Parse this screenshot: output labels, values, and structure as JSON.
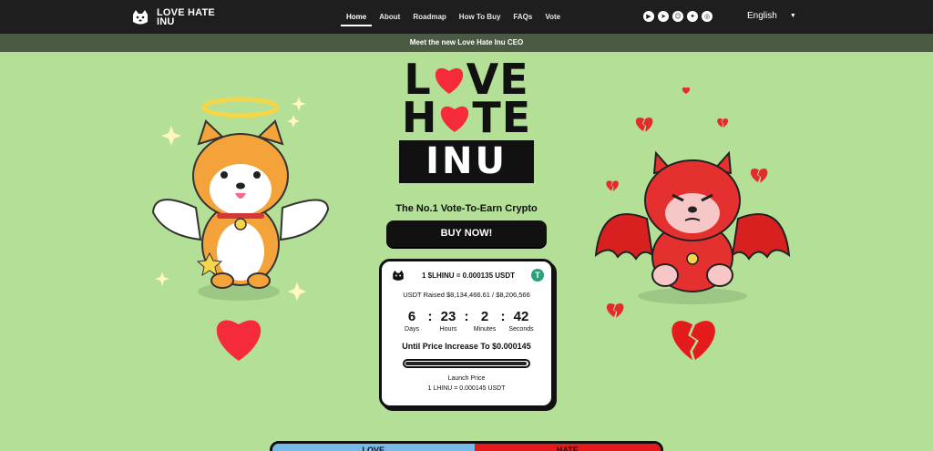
{
  "nav": {
    "logo_text": "LOVE HATE INU",
    "links": [
      {
        "label": "Home",
        "active": true
      },
      {
        "label": "About",
        "active": false
      },
      {
        "label": "Roadmap",
        "active": false
      },
      {
        "label": "How To Buy",
        "active": false
      },
      {
        "label": "FAQs",
        "active": false
      },
      {
        "label": "Vote",
        "active": false
      }
    ],
    "socials": [
      "youtube-icon",
      "telegram-icon",
      "discord-icon",
      "twitter-icon",
      "instagram-icon"
    ],
    "language": "English"
  },
  "banner": {
    "text": "Meet the new Love Hate Inu CEO"
  },
  "hero": {
    "line1": [
      "L",
      "VE"
    ],
    "line2": [
      "H",
      "TE"
    ],
    "line3": "INU",
    "tagline": "The No.1 Vote-To-Earn Crypto",
    "buy_label": "BUY NOW!"
  },
  "presale": {
    "price": "1 $LHINU = 0.000135 USDT",
    "raised": "USDT Raised $8,134,466.61 / $8,206,566",
    "progress_fraction": 0.991,
    "countdown": {
      "days": "6",
      "hours": "23",
      "minutes": "2",
      "seconds": "42",
      "days_label": "Days",
      "hours_label": "Hours",
      "minutes_label": "Minutes",
      "seconds_label": "Seconds"
    },
    "until": "Until Price Increase To $0.000145",
    "launch_label": "Launch Price",
    "launch_price": "1 LHINU = 0.000145 USDT"
  },
  "vote": {
    "love": "LOVE",
    "hate": "HATE"
  },
  "colors": {
    "background": "#b3e096",
    "nav": "#1e1e1e",
    "banner": "#4a5a43",
    "heart": "#f52a3a",
    "usdt": "#26a17b"
  }
}
